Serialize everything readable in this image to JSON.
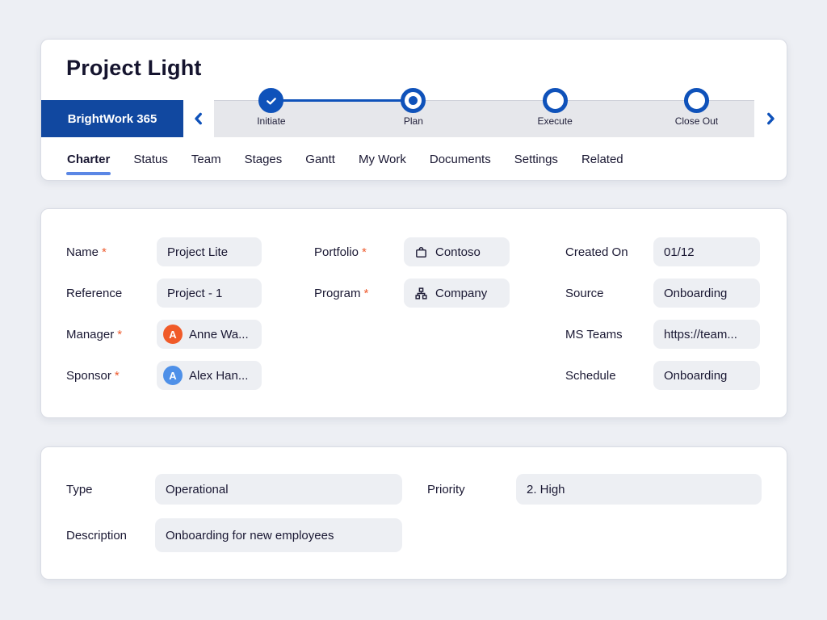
{
  "ui": {
    "required_marker": "*"
  },
  "header": {
    "title": "Project Light",
    "brand": "BrightWork 365"
  },
  "stages": [
    {
      "label": "Initiate",
      "state": "done"
    },
    {
      "label": "Plan",
      "state": "current"
    },
    {
      "label": "Execute",
      "state": "todo"
    },
    {
      "label": "Close Out",
      "state": "todo"
    }
  ],
  "tabs": [
    {
      "label": "Charter",
      "active": true
    },
    {
      "label": "Status"
    },
    {
      "label": "Team"
    },
    {
      "label": "Stages"
    },
    {
      "label": "Gantt"
    },
    {
      "label": "My Work"
    },
    {
      "label": "Documents"
    },
    {
      "label": "Settings"
    },
    {
      "label": "Related"
    }
  ],
  "charter": {
    "name": {
      "label": "Name",
      "required": true,
      "value": "Project Lite"
    },
    "reference": {
      "label": "Reference",
      "required": false,
      "value": "Project - 1"
    },
    "manager": {
      "label": "Manager",
      "required": true,
      "value": "Anne Wa...",
      "avatar_initial": "A",
      "avatar_color": "#f05a28"
    },
    "sponsor": {
      "label": "Sponsor",
      "required": true,
      "value": "Alex Han...",
      "avatar_initial": "A",
      "avatar_color": "#4e90e8"
    },
    "portfolio": {
      "label": "Portfolio",
      "required": true,
      "value": "Contoso",
      "icon": "briefcase-icon"
    },
    "program": {
      "label": "Program",
      "required": true,
      "value": "Company",
      "icon": "org-chart-icon"
    },
    "created_on": {
      "label": "Created On",
      "required": false,
      "value": "01/12"
    },
    "source": {
      "label": "Source",
      "required": false,
      "value": "Onboarding"
    },
    "ms_teams": {
      "label": "MS Teams",
      "required": false,
      "value": "https://team..."
    },
    "schedule": {
      "label": "Schedule",
      "required": false,
      "value": "Onboarding"
    }
  },
  "details": {
    "type": {
      "label": "Type",
      "value": "Operational"
    },
    "priority": {
      "label": "Priority",
      "value": "2. High"
    },
    "description": {
      "label": "Description",
      "value": "Onboarding for new employees"
    }
  },
  "colors": {
    "brand_blue": "#1148a0",
    "stage_blue": "#0f52ba",
    "tab_underline": "#5b87e5",
    "required_marker": "#ee5b2e",
    "avatar_orange": "#f05a28",
    "avatar_blue": "#4e90e8",
    "field_bg": "#edeff3",
    "page_bg": "#edeff4",
    "stage_track_bg": "#e6e7eb",
    "text": "#1a1833"
  }
}
